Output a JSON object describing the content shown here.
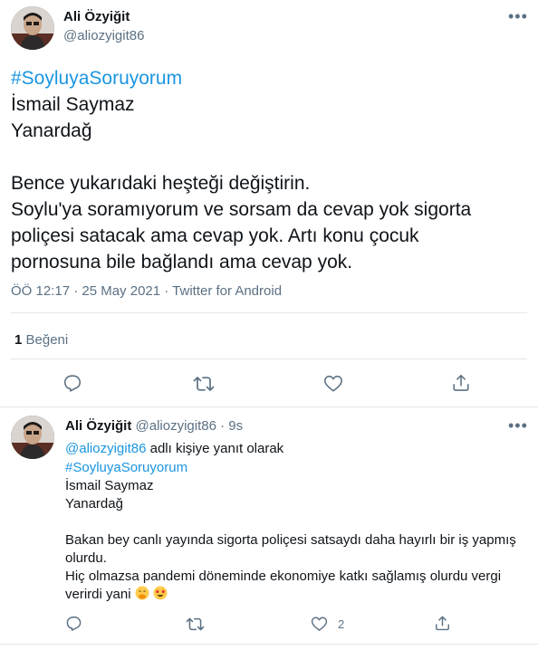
{
  "tweet": {
    "author_name": "Ali Özyiğit",
    "author_handle": "@aliozyigit86",
    "hashtag": "#SoyluyaSoruyorum",
    "lines": [
      "İsmail Saymaz",
      "Yanardağ",
      "",
      "Bence yukarıdaki heşteği değiştirin.",
      "Soylu'ya soramıyorum ve sorsam da cevap yok sigorta",
      "poliçesi satacak ama cevap yok. Artı konu çocuk",
      "pornosuna bile bağlandı ama cevap yok."
    ],
    "timestamp": "ÖÖ 12:17 · 25 May 2021 · Twitter for Android",
    "likes_count": "1",
    "likes_label": "Beğeni"
  },
  "reply": {
    "author_name": "Ali Özyiğit",
    "author_handle": "@aliozyigit86",
    "time": "· 9s",
    "replying_to_handle": "@aliozyigit86",
    "replying_to_suffix": "adlı kişiye yanıt olarak",
    "hashtag": "#SoyluyaSoruyorum",
    "lines": [
      "İsmail Saymaz",
      "Yanardağ",
      "",
      "Bakan bey canlı yayında sigorta poliçesi satsaydı daha hayırlı bir iş yapmış",
      "olurdu.",
      "Hiç olmazsa pandemi döneminde ekonomiye katkı sağlamış olurdu vergi"
    ],
    "last_line": "verirdi yani",
    "like_count": "2"
  },
  "colors": {
    "link": "#1b95e0",
    "secondary_text": "#5b7083",
    "divider": "#e1e8ed"
  }
}
